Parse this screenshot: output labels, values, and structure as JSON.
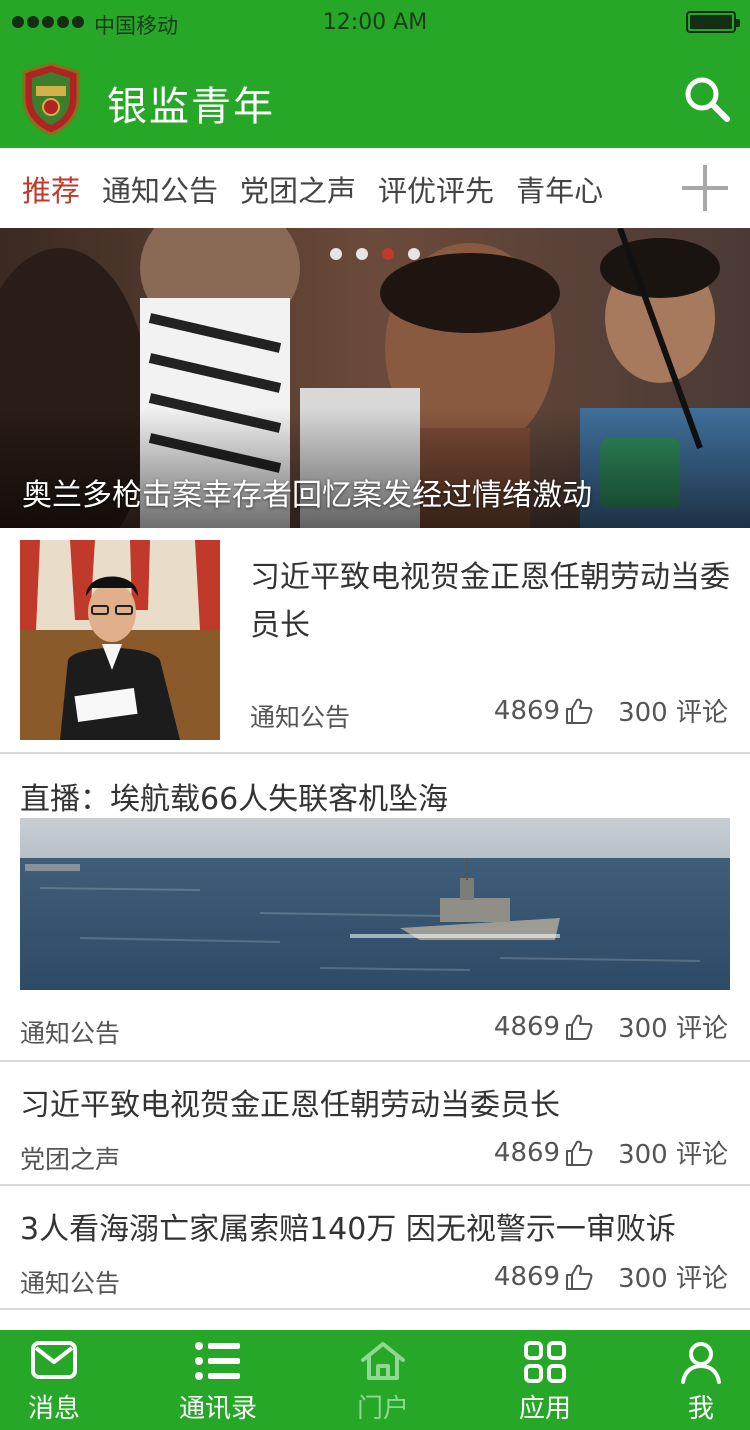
{
  "status_bar": {
    "carrier": "中国移动",
    "time": "12:00 AM",
    "battery_level": 1.0
  },
  "header": {
    "title": "银监青年",
    "logo_icon": "shield-logo-icon",
    "search_icon": "search-icon"
  },
  "tabs": {
    "items": [
      {
        "label": "推荐",
        "active": true
      },
      {
        "label": "通知公告",
        "active": false
      },
      {
        "label": "党团之声",
        "active": false
      },
      {
        "label": "评优评先",
        "active": false
      },
      {
        "label": "青年心",
        "active": false
      }
    ],
    "add_icon": "plus-icon"
  },
  "banner": {
    "caption": "奥兰多枪击案幸存者回忆案发经过情绪激动",
    "slide_count": 4,
    "active_slide": 3
  },
  "news": [
    {
      "title": "习近平致电视贺金正恩任朝劳动当委员长",
      "category": "通知公告",
      "likes": "4869",
      "comments": "300 评论"
    },
    {
      "title": "直播：埃航载66人失联客机坠海",
      "category": "通知公告",
      "likes": "4869",
      "comments": "300 评论"
    },
    {
      "title": "习近平致电视贺金正恩任朝劳动当委员长",
      "category": "党团之声",
      "likes": "4869",
      "comments": "300 评论"
    },
    {
      "title": "3人看海溺亡家属索赔140万 因无视警示一审败诉",
      "category": "通知公告",
      "likes": "4869",
      "comments": "300 评论"
    }
  ],
  "bottom_nav": {
    "items": [
      {
        "label": "消息",
        "icon": "mail-icon",
        "active": true
      },
      {
        "label": "通讯录",
        "icon": "list-icon",
        "active": true
      },
      {
        "label": "门户",
        "icon": "home-icon",
        "active": false
      },
      {
        "label": "应用",
        "icon": "grid-apps-icon",
        "active": true
      },
      {
        "label": "我",
        "icon": "user-icon",
        "active": true
      }
    ]
  },
  "colors": {
    "primary_green": "#27a727",
    "active_tab_red": "#c0392b"
  }
}
